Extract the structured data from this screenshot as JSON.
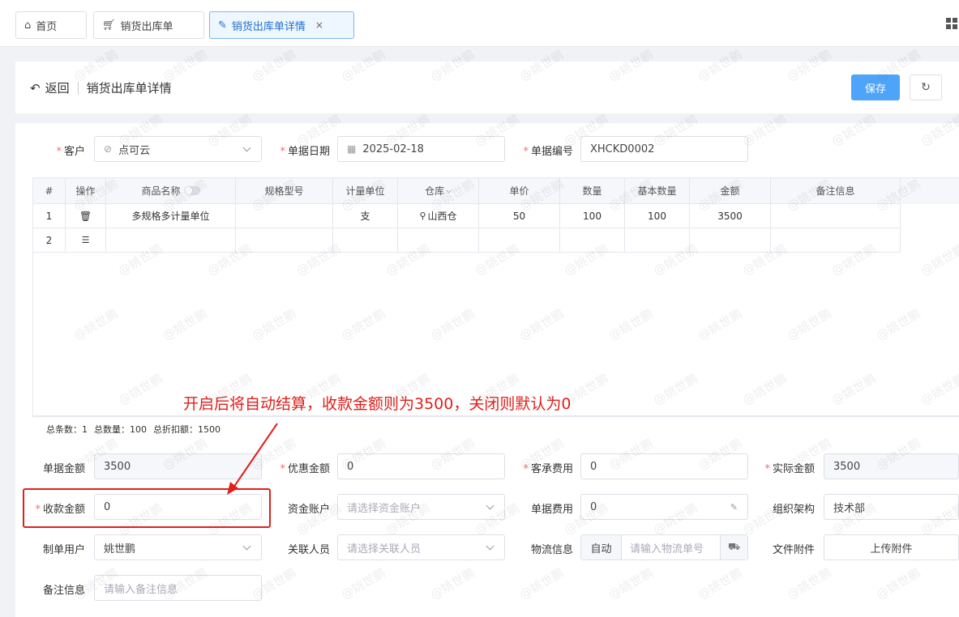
{
  "tabs": [
    {
      "label": "首页",
      "icon": "home-icon"
    },
    {
      "label": "销货出库单",
      "icon": "cart-icon"
    },
    {
      "label": "销货出库单详情",
      "icon": "document-edit-icon",
      "active": true
    }
  ],
  "header": {
    "back_label": "返回",
    "title": "销货出库单详情",
    "save_label": "保存"
  },
  "form_top": {
    "customer_label": "客户",
    "customer_value": "点可云",
    "date_label": "单据日期",
    "date_value": "2025-02-18",
    "number_label": "单据编号",
    "number_value": "XHCKD0002"
  },
  "table": {
    "columns": [
      "#",
      "操作",
      "商品名称",
      "规格型号",
      "计量单位",
      "仓库",
      "单价",
      "数量",
      "基本数量",
      "金额",
      "备注信息"
    ],
    "rows": [
      [
        "1",
        "",
        "多规格多计量单位",
        "",
        "支",
        "山西仓",
        "50",
        "100",
        "100",
        "3500",
        ""
      ],
      [
        "2",
        "",
        "",
        "",
        "",
        "",
        "",
        "",
        "",
        "",
        ""
      ]
    ],
    "footer": {
      "count": "总条数：1",
      "qty": "总数量：100",
      "discount": "总折扣额：1500"
    }
  },
  "annotation": "开启后将自动结算，收款金额则为3500，关闭则默认为0",
  "form_bottom": {
    "bill_amount_label": "单据金额",
    "bill_amount_value": "3500",
    "discount_amount_label": "优惠金额",
    "discount_amount_value": "0",
    "freight_label": "客承费用",
    "freight_value": "0",
    "actual_amount_label": "实际金额",
    "actual_amount_value": "3500",
    "received_label": "收款金额",
    "received_value": "0",
    "account_label": "资金账户",
    "account_placeholder": "请选择资金账户",
    "bill_fee_label": "单据费用",
    "bill_fee_value": "0",
    "org_label": "组织架构",
    "org_value": "技术部",
    "maker_label": "制单用户",
    "maker_value": "姚世鹏",
    "related_label": "关联人员",
    "related_placeholder": "请选择关联人员",
    "logistics_label": "物流信息",
    "logistics_mode": "自动",
    "logistics_placeholder": "请输入物流单号",
    "attachment_label": "文件附件",
    "attachment_button": "上传附件",
    "remark_label": "备注信息",
    "remark_placeholder": "请输入备注信息"
  },
  "watermark": "@姚世鹏",
  "colors": {
    "primary": "#4ea4f8",
    "annotation_red": "#e0201b",
    "required": "#f56c6c"
  }
}
